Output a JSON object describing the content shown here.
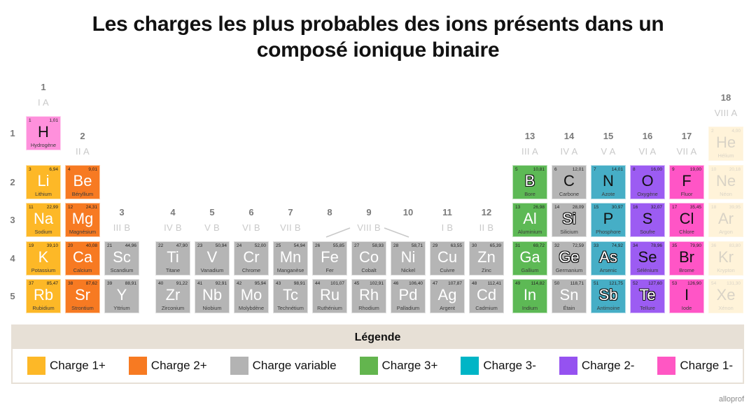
{
  "title": {
    "line1": "Les charges les plus probables des ions présents dans un",
    "line2": "composé ionique binaire"
  },
  "groups": [
    {
      "group": 1,
      "number": "1",
      "roman": "I A"
    },
    {
      "group": 2,
      "number": "2",
      "roman": "II A"
    },
    {
      "group": 3,
      "number": "3",
      "roman": "III B"
    },
    {
      "group": 4,
      "number": "4",
      "roman": "IV B"
    },
    {
      "group": 5,
      "number": "5",
      "roman": "V B"
    },
    {
      "group": 6,
      "number": "6",
      "roman": "VI B"
    },
    {
      "group": 7,
      "number": "7",
      "roman": "VII B"
    },
    {
      "group": 8,
      "number": "8",
      "roman": ""
    },
    {
      "group": 9,
      "number": "9",
      "roman": "VIII B"
    },
    {
      "group": 10,
      "number": "10",
      "roman": ""
    },
    {
      "group": 11,
      "number": "11",
      "roman": "I B"
    },
    {
      "group": 12,
      "number": "12",
      "roman": "II B"
    },
    {
      "group": 13,
      "number": "13",
      "roman": "III A"
    },
    {
      "group": 14,
      "number": "14",
      "roman": "IV A"
    },
    {
      "group": 15,
      "number": "15",
      "roman": "V A"
    },
    {
      "group": 16,
      "number": "16",
      "roman": "VI A"
    },
    {
      "group": 17,
      "number": "17",
      "roman": "VII A"
    },
    {
      "group": 18,
      "number": "18",
      "roman": "VIII A"
    }
  ],
  "periods": [
    "1",
    "2",
    "3",
    "4",
    "5"
  ],
  "category_colors": {
    "hydrogen": "#FF90DC",
    "charge-1plus": "#FDB827",
    "charge-2plus": "#F77A22",
    "variable": "#B5B5B5",
    "charge-3plus": "#5DB955",
    "charge-3minus": "#46AEC6",
    "charge-2minus": "#9C5CF2",
    "charge-1minus": "#FF55C6",
    "noble": "#FFF3D9"
  },
  "elements": [
    {
      "symbol": "H",
      "number": "1",
      "mass": "1,01",
      "name": "Hydrogène",
      "group": 1,
      "period": 1,
      "category": "hydrogen",
      "kind": "nonmetal"
    },
    {
      "symbol": "He",
      "number": "2",
      "mass": "4,00",
      "name": "Hélium",
      "group": 18,
      "period": 1,
      "category": "noble",
      "kind": "noble"
    },
    {
      "symbol": "Li",
      "number": "3",
      "mass": "6,94",
      "name": "Lithium",
      "group": 1,
      "period": 2,
      "category": "charge-1plus",
      "kind": "metal"
    },
    {
      "symbol": "Be",
      "number": "4",
      "mass": "9,01",
      "name": "Béryllium",
      "group": 2,
      "period": 2,
      "category": "charge-2plus",
      "kind": "metal"
    },
    {
      "symbol": "B",
      "number": "5",
      "mass": "10,81",
      "name": "Bore",
      "group": 13,
      "period": 2,
      "category": "charge-3plus",
      "kind": "metalloid"
    },
    {
      "symbol": "C",
      "number": "6",
      "mass": "12,01",
      "name": "Carbone",
      "group": 14,
      "period": 2,
      "category": "variable",
      "kind": "nonmetal"
    },
    {
      "symbol": "N",
      "number": "7",
      "mass": "14,01",
      "name": "Azote",
      "group": 15,
      "period": 2,
      "category": "charge-3minus",
      "kind": "nonmetal"
    },
    {
      "symbol": "O",
      "number": "8",
      "mass": "16,00",
      "name": "Oxygène",
      "group": 16,
      "period": 2,
      "category": "charge-2minus",
      "kind": "nonmetal"
    },
    {
      "symbol": "F",
      "number": "9",
      "mass": "19,00",
      "name": "Fluor",
      "group": 17,
      "period": 2,
      "category": "charge-1minus",
      "kind": "nonmetal"
    },
    {
      "symbol": "Ne",
      "number": "10",
      "mass": "20,18",
      "name": "Néon",
      "group": 18,
      "period": 2,
      "category": "noble",
      "kind": "noble"
    },
    {
      "symbol": "Na",
      "number": "11",
      "mass": "22,99",
      "name": "Sodium",
      "group": 1,
      "period": 3,
      "category": "charge-1plus",
      "kind": "metal"
    },
    {
      "symbol": "Mg",
      "number": "12",
      "mass": "24,31",
      "name": "Magnésium",
      "group": 2,
      "period": 3,
      "category": "charge-2plus",
      "kind": "metal"
    },
    {
      "symbol": "Al",
      "number": "13",
      "mass": "26,98",
      "name": "Aluminium",
      "group": 13,
      "period": 3,
      "category": "charge-3plus",
      "kind": "metal"
    },
    {
      "symbol": "Si",
      "number": "14",
      "mass": "28,09",
      "name": "Silicium",
      "group": 14,
      "period": 3,
      "category": "variable",
      "kind": "metalloid"
    },
    {
      "symbol": "P",
      "number": "15",
      "mass": "30,97",
      "name": "Phosphore",
      "group": 15,
      "period": 3,
      "category": "charge-3minus",
      "kind": "nonmetal"
    },
    {
      "symbol": "S",
      "number": "16",
      "mass": "32,07",
      "name": "Soufre",
      "group": 16,
      "period": 3,
      "category": "charge-2minus",
      "kind": "nonmetal"
    },
    {
      "symbol": "Cl",
      "number": "17",
      "mass": "35,45",
      "name": "Chlore",
      "group": 17,
      "period": 3,
      "category": "charge-1minus",
      "kind": "nonmetal"
    },
    {
      "symbol": "Ar",
      "number": "18",
      "mass": "39,95",
      "name": "Argon",
      "group": 18,
      "period": 3,
      "category": "noble",
      "kind": "noble"
    },
    {
      "symbol": "K",
      "number": "19",
      "mass": "39,10",
      "name": "Potassium",
      "group": 1,
      "period": 4,
      "category": "charge-1plus",
      "kind": "metal"
    },
    {
      "symbol": "Ca",
      "number": "20",
      "mass": "40,08",
      "name": "Calcium",
      "group": 2,
      "period": 4,
      "category": "charge-2plus",
      "kind": "metal"
    },
    {
      "symbol": "Sc",
      "number": "21",
      "mass": "44,96",
      "name": "Scandium",
      "group": 3,
      "period": 4,
      "category": "variable",
      "kind": "metal"
    },
    {
      "symbol": "Ti",
      "number": "22",
      "mass": "47,90",
      "name": "Titane",
      "group": 4,
      "period": 4,
      "category": "variable",
      "kind": "metal"
    },
    {
      "symbol": "V",
      "number": "23",
      "mass": "50,94",
      "name": "Vanadium",
      "group": 5,
      "period": 4,
      "category": "variable",
      "kind": "metal"
    },
    {
      "symbol": "Cr",
      "number": "24",
      "mass": "52,00",
      "name": "Chrome",
      "group": 6,
      "period": 4,
      "category": "variable",
      "kind": "metal"
    },
    {
      "symbol": "Mn",
      "number": "25",
      "mass": "54,94",
      "name": "Manganèse",
      "group": 7,
      "period": 4,
      "category": "variable",
      "kind": "metal"
    },
    {
      "symbol": "Fe",
      "number": "26",
      "mass": "55,85",
      "name": "Fer",
      "group": 8,
      "period": 4,
      "category": "variable",
      "kind": "metal"
    },
    {
      "symbol": "Co",
      "number": "27",
      "mass": "58,93",
      "name": "Cobalt",
      "group": 9,
      "period": 4,
      "category": "variable",
      "kind": "metal"
    },
    {
      "symbol": "Ni",
      "number": "28",
      "mass": "58,71",
      "name": "Nickel",
      "group": 10,
      "period": 4,
      "category": "variable",
      "kind": "metal"
    },
    {
      "symbol": "Cu",
      "number": "29",
      "mass": "63,55",
      "name": "Cuivre",
      "group": 11,
      "period": 4,
      "category": "variable",
      "kind": "metal"
    },
    {
      "symbol": "Zn",
      "number": "30",
      "mass": "65,39",
      "name": "Zinc",
      "group": 12,
      "period": 4,
      "category": "variable",
      "kind": "metal"
    },
    {
      "symbol": "Ga",
      "number": "31",
      "mass": "69,72",
      "name": "Gallium",
      "group": 13,
      "period": 4,
      "category": "charge-3plus",
      "kind": "metal"
    },
    {
      "symbol": "Ge",
      "number": "32",
      "mass": "72,59",
      "name": "Germanium",
      "group": 14,
      "period": 4,
      "category": "variable",
      "kind": "metalloid"
    },
    {
      "symbol": "As",
      "number": "33",
      "mass": "74,92",
      "name": "Arsenic",
      "group": 15,
      "period": 4,
      "category": "charge-3minus",
      "kind": "metalloid"
    },
    {
      "symbol": "Se",
      "number": "34",
      "mass": "78,96",
      "name": "Sélénium",
      "group": 16,
      "period": 4,
      "category": "charge-2minus",
      "kind": "nonmetal"
    },
    {
      "symbol": "Br",
      "number": "35",
      "mass": "79,90",
      "name": "Brome",
      "group": 17,
      "period": 4,
      "category": "charge-1minus",
      "kind": "nonmetal"
    },
    {
      "symbol": "Kr",
      "number": "36",
      "mass": "83,80",
      "name": "Krypton",
      "group": 18,
      "period": 4,
      "category": "noble",
      "kind": "noble"
    },
    {
      "symbol": "Rb",
      "number": "37",
      "mass": "85,47",
      "name": "Rubidium",
      "group": 1,
      "period": 5,
      "category": "charge-1plus",
      "kind": "metal"
    },
    {
      "symbol": "Sr",
      "number": "38",
      "mass": "87,62",
      "name": "Strontium",
      "group": 2,
      "period": 5,
      "category": "charge-2plus",
      "kind": "metal"
    },
    {
      "symbol": "Y",
      "number": "39",
      "mass": "88,91",
      "name": "Yttrium",
      "group": 3,
      "period": 5,
      "category": "variable",
      "kind": "metal"
    },
    {
      "symbol": "Zr",
      "number": "40",
      "mass": "91,22",
      "name": "Zirconium",
      "group": 4,
      "period": 5,
      "category": "variable",
      "kind": "metal"
    },
    {
      "symbol": "Nb",
      "number": "41",
      "mass": "92,91",
      "name": "Niobium",
      "group": 5,
      "period": 5,
      "category": "variable",
      "kind": "metal"
    },
    {
      "symbol": "Mo",
      "number": "42",
      "mass": "95,94",
      "name": "Molybdène",
      "group": 6,
      "period": 5,
      "category": "variable",
      "kind": "metal"
    },
    {
      "symbol": "Tc",
      "number": "43",
      "mass": "98,91",
      "name": "Technétium",
      "group": 7,
      "period": 5,
      "category": "variable",
      "kind": "metal"
    },
    {
      "symbol": "Ru",
      "number": "44",
      "mass": "101,07",
      "name": "Ruthénium",
      "group": 8,
      "period": 5,
      "category": "variable",
      "kind": "metal"
    },
    {
      "symbol": "Rh",
      "number": "45",
      "mass": "102,91",
      "name": "Rhodium",
      "group": 9,
      "period": 5,
      "category": "variable",
      "kind": "metal"
    },
    {
      "symbol": "Pd",
      "number": "46",
      "mass": "106,40",
      "name": "Palladium",
      "group": 10,
      "period": 5,
      "category": "variable",
      "kind": "metal"
    },
    {
      "symbol": "Ag",
      "number": "47",
      "mass": "107,87",
      "name": "Argent",
      "group": 11,
      "period": 5,
      "category": "variable",
      "kind": "metal"
    },
    {
      "symbol": "Cd",
      "number": "48",
      "mass": "112,41",
      "name": "Cadmium",
      "group": 12,
      "period": 5,
      "category": "variable",
      "kind": "metal"
    },
    {
      "symbol": "In",
      "number": "49",
      "mass": "114,82",
      "name": "Indium",
      "group": 13,
      "period": 5,
      "category": "charge-3plus",
      "kind": "metal"
    },
    {
      "symbol": "Sn",
      "number": "50",
      "mass": "118,71",
      "name": "Étain",
      "group": 14,
      "period": 5,
      "category": "variable",
      "kind": "metal"
    },
    {
      "symbol": "Sb",
      "number": "51",
      "mass": "121,75",
      "name": "Antimoine",
      "group": 15,
      "period": 5,
      "category": "charge-3minus",
      "kind": "metalloid"
    },
    {
      "symbol": "Te",
      "number": "52",
      "mass": "127,60",
      "name": "Tellure",
      "group": 16,
      "period": 5,
      "category": "charge-2minus",
      "kind": "metalloid"
    },
    {
      "symbol": "I",
      "number": "53",
      "mass": "126,90",
      "name": "Iode",
      "group": 17,
      "period": 5,
      "category": "charge-1minus",
      "kind": "nonmetal"
    },
    {
      "symbol": "Xe",
      "number": "54",
      "mass": "131,30",
      "name": "Xénon",
      "group": 18,
      "period": 5,
      "category": "noble",
      "kind": "noble"
    }
  ],
  "legend": {
    "title": "Légende",
    "items": [
      {
        "label": "Charge 1+",
        "color": "#FDB827"
      },
      {
        "label": "Charge 2+",
        "color": "#F77A22"
      },
      {
        "label": "Charge variable",
        "color": "#B3B3B3"
      },
      {
        "label": "Charge 3+",
        "color": "#63B54E"
      },
      {
        "label": "Charge 3-",
        "color": "#00B5C6"
      },
      {
        "label": "Charge 2-",
        "color": "#9552F0"
      },
      {
        "label": "Charge 1-",
        "color": "#FF57C3"
      }
    ]
  },
  "credit": "alloprof"
}
